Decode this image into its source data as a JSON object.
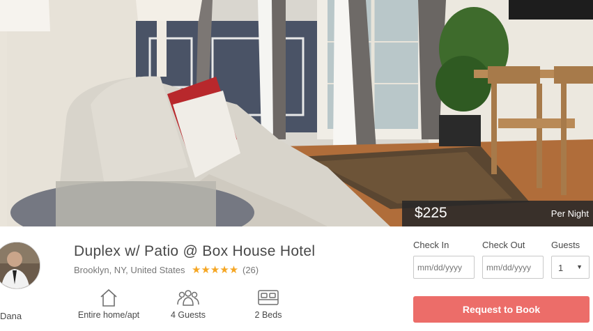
{
  "listing": {
    "price": "$225",
    "price_period": "Per Night",
    "title": "Duplex w/ Patio @ Box House Hotel",
    "location": "Brooklyn, NY, United States",
    "rating_stars": "★★★★★",
    "rating_value": 5,
    "review_count": "(26)"
  },
  "host": {
    "name": "Dana"
  },
  "amenities": [
    {
      "icon": "home-icon",
      "label": "Entire home/apt"
    },
    {
      "icon": "guests-icon",
      "label": "4 Guests"
    },
    {
      "icon": "bed-icon",
      "label": "2 Beds"
    }
  ],
  "booking": {
    "check_in_label": "Check In",
    "check_in_placeholder": "mm/dd/yyyy",
    "check_out_label": "Check Out",
    "check_out_placeholder": "mm/dd/yyyy",
    "guests_label": "Guests",
    "guests_value": "1",
    "submit_label": "Request to Book"
  },
  "colors": {
    "accent": "#ec6d69",
    "star": "#f5a623",
    "text": "#484848",
    "muted": "#767676"
  }
}
